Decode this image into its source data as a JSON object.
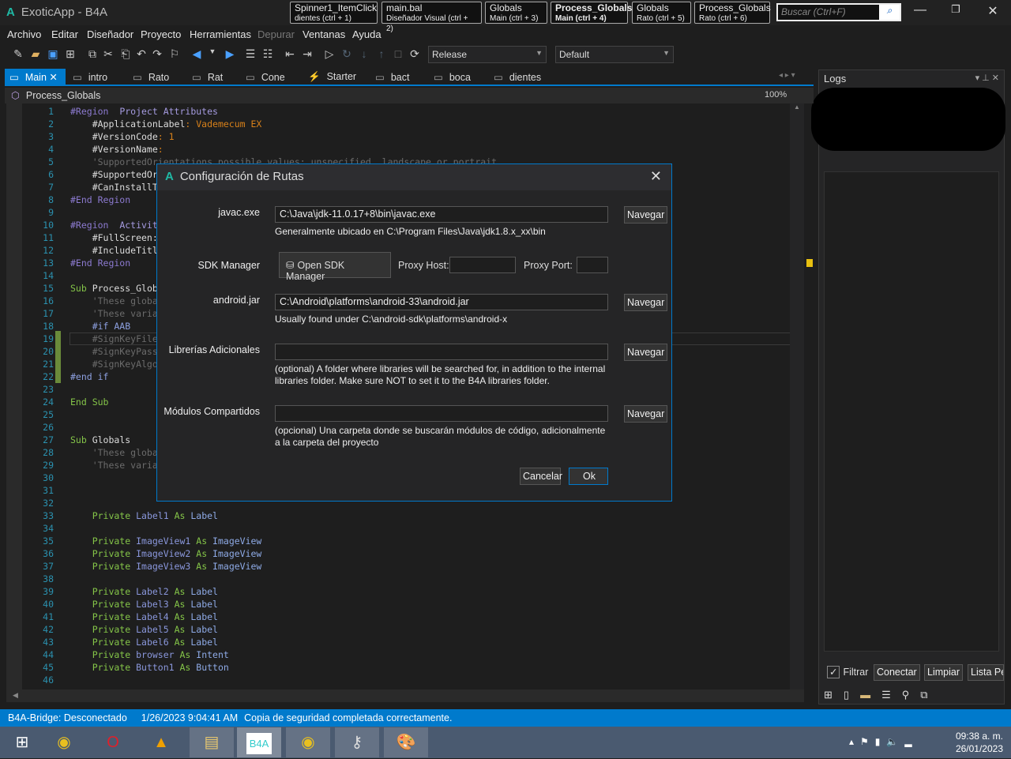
{
  "window": {
    "title": "ExoticApp - B4A",
    "logo": "A"
  },
  "quick_tabs": [
    {
      "name": "Spinner1_ItemClick",
      "sub": "dientes  (ctrl + 1)"
    },
    {
      "name": "main.bal",
      "sub": "Diseñador Visual  (ctrl + 2)"
    },
    {
      "name": "Globals",
      "sub": "Main  (ctrl + 3)"
    },
    {
      "name": "Process_Globals",
      "sub": "Main  (ctrl + 4)"
    },
    {
      "name": "Globals",
      "sub": "Rato  (ctrl + 5)"
    },
    {
      "name": "Process_Globals",
      "sub": "Rato  (ctrl + 6)"
    }
  ],
  "search": {
    "placeholder": "Buscar (Ctrl+F)"
  },
  "menu": [
    "Archivo",
    "Editar",
    "Diseñador",
    "Proyecto",
    "Herramientas",
    "Depurar",
    "Ventanas",
    "Ayuda"
  ],
  "toolbar": {
    "build_config": "Release",
    "device": "Default"
  },
  "tabs": [
    {
      "label": "Main",
      "active": true
    },
    {
      "label": "intro"
    },
    {
      "label": "Rato"
    },
    {
      "label": "Rat"
    },
    {
      "label": "Cone"
    },
    {
      "label": "Starter"
    },
    {
      "label": "bact"
    },
    {
      "label": "boca"
    },
    {
      "label": "dientes"
    }
  ],
  "breadcrumb": "Process_Globals",
  "editor": {
    "zoom": "100%",
    "lines": [
      [
        [
          "#Region",
          "r"
        ],
        [
          "  Project Attributes",
          "rn"
        ]
      ],
      [
        [
          "    #ApplicationLabel",
          "w"
        ],
        [
          ": Vademecum EX",
          "o"
        ]
      ],
      [
        [
          "    #VersionCode",
          "w"
        ],
        [
          ": 1",
          "o"
        ]
      ],
      [
        [
          "    #VersionName",
          "w"
        ],
        [
          ":",
          "o"
        ]
      ],
      [
        [
          "    'SupportedOrientations possible values: unspecified, landscape or portrait.",
          "c"
        ]
      ],
      [
        [
          "    #SupportedOr",
          "w"
        ]
      ],
      [
        [
          "    #CanInstallT",
          "w"
        ]
      ],
      [
        [
          "#End Region",
          "r"
        ]
      ],
      [],
      [
        [
          "#Region",
          "r"
        ],
        [
          "  Activit",
          "rn"
        ]
      ],
      [
        [
          "    #FullScreen:",
          "w"
        ]
      ],
      [
        [
          "    #IncludeTitl",
          "w"
        ]
      ],
      [
        [
          "#End Region",
          "r"
        ]
      ],
      [],
      [
        [
          "Sub ",
          "g"
        ],
        [
          "Process_Glob",
          "w"
        ]
      ],
      [
        [
          "    'These globa",
          "c"
        ]
      ],
      [
        [
          "    'These varia",
          "c"
        ]
      ],
      [
        [
          "    #if AAB",
          "p"
        ]
      ],
      [
        [
          "    #SignKeyFile",
          "c"
        ]
      ],
      [
        [
          "    #SignKeyPass",
          "c"
        ]
      ],
      [
        [
          "    #SignKeyAlgo",
          "c"
        ]
      ],
      [
        [
          "#end if",
          "p"
        ]
      ],
      [],
      [
        [
          "End Sub",
          "g"
        ]
      ],
      [],
      [],
      [
        [
          "Sub ",
          "g"
        ],
        [
          "Globals",
          "w"
        ]
      ],
      [
        [
          "    'These globa",
          "c"
        ]
      ],
      [
        [
          "    'These varia",
          "c"
        ]
      ],
      [],
      [],
      [],
      [
        [
          "    Private ",
          "g"
        ],
        [
          "Label1 ",
          "b"
        ],
        [
          "As ",
          "g"
        ],
        [
          "Label",
          "t"
        ]
      ],
      [],
      [
        [
          "    Private ",
          "g"
        ],
        [
          "ImageView1 ",
          "b"
        ],
        [
          "As ",
          "g"
        ],
        [
          "ImageView",
          "t"
        ]
      ],
      [
        [
          "    Private ",
          "g"
        ],
        [
          "ImageView2 ",
          "b"
        ],
        [
          "As ",
          "g"
        ],
        [
          "ImageView",
          "t"
        ]
      ],
      [
        [
          "    Private ",
          "g"
        ],
        [
          "ImageView3 ",
          "b"
        ],
        [
          "As ",
          "g"
        ],
        [
          "ImageView",
          "t"
        ]
      ],
      [],
      [
        [
          "    Private ",
          "g"
        ],
        [
          "Label2 ",
          "b"
        ],
        [
          "As ",
          "g"
        ],
        [
          "Label",
          "t"
        ]
      ],
      [
        [
          "    Private ",
          "g"
        ],
        [
          "Label3 ",
          "b"
        ],
        [
          "As ",
          "g"
        ],
        [
          "Label",
          "t"
        ]
      ],
      [
        [
          "    Private ",
          "g"
        ],
        [
          "Label4 ",
          "b"
        ],
        [
          "As ",
          "g"
        ],
        [
          "Label",
          "t"
        ]
      ],
      [
        [
          "    Private ",
          "g"
        ],
        [
          "Label5 ",
          "b"
        ],
        [
          "As ",
          "g"
        ],
        [
          "Label",
          "t"
        ]
      ],
      [
        [
          "    Private ",
          "g"
        ],
        [
          "Label6 ",
          "b"
        ],
        [
          "As ",
          "g"
        ],
        [
          "Label",
          "t"
        ]
      ],
      [
        [
          "    Private ",
          "g"
        ],
        [
          "browser ",
          "b"
        ],
        [
          "As ",
          "g"
        ],
        [
          "Intent",
          "t"
        ]
      ],
      [
        [
          "    Private ",
          "g"
        ],
        [
          "Button1 ",
          "b"
        ],
        [
          "As ",
          "g"
        ],
        [
          "Button",
          "t"
        ]
      ],
      []
    ]
  },
  "logs": {
    "title": "Logs",
    "filter_label": "Filtrar",
    "filter_checked": true,
    "connect": "Conectar",
    "clear": "Limpiar",
    "list": "Lista Pe"
  },
  "status": {
    "bridge": "B4A-Bridge: Desconectado",
    "timestamp": "1/26/2023 9:04:41 AM",
    "message": "Copia de seguridad completada correctamente."
  },
  "dialog": {
    "title": "Configuración de Rutas",
    "javac_label": "javac.exe",
    "javac_value": "C:\\Java\\jdk-11.0.17+8\\bin\\javac.exe",
    "javac_hint": "Generalmente ubicado en C:\\Program Files\\Java\\jdk1.8.x_xx\\bin",
    "sdk_label": "SDK Manager",
    "sdk_button": "Open SDK Manager",
    "proxy_host_label": "Proxy Host:",
    "proxy_host": "",
    "proxy_port_label": "Proxy Port:",
    "proxy_port": "",
    "android_label": "android.jar",
    "android_value": "C:\\Android\\platforms\\android-33\\android.jar",
    "android_hint": "Usually found under C:\\android-sdk\\platforms\\android-x",
    "libs_label": "Librerías Adicionales",
    "libs_value": "",
    "libs_hint": "(optional) A folder where libraries will be searched for, in addition to the internal libraries folder. Make sure NOT to set it to the B4A libraries folder.",
    "modules_label": "Módulos Compartidos",
    "modules_value": "",
    "modules_hint": "(opcional) Una carpeta donde se buscarán módulos de código, adicionalmente a la carpeta del proyecto",
    "browse": "Navegar",
    "cancel": "Cancelar",
    "ok": "Ok"
  },
  "taskbar": {
    "b4a_label": "B4A",
    "time": "09:38 a. m.",
    "date": "26/01/2023"
  }
}
